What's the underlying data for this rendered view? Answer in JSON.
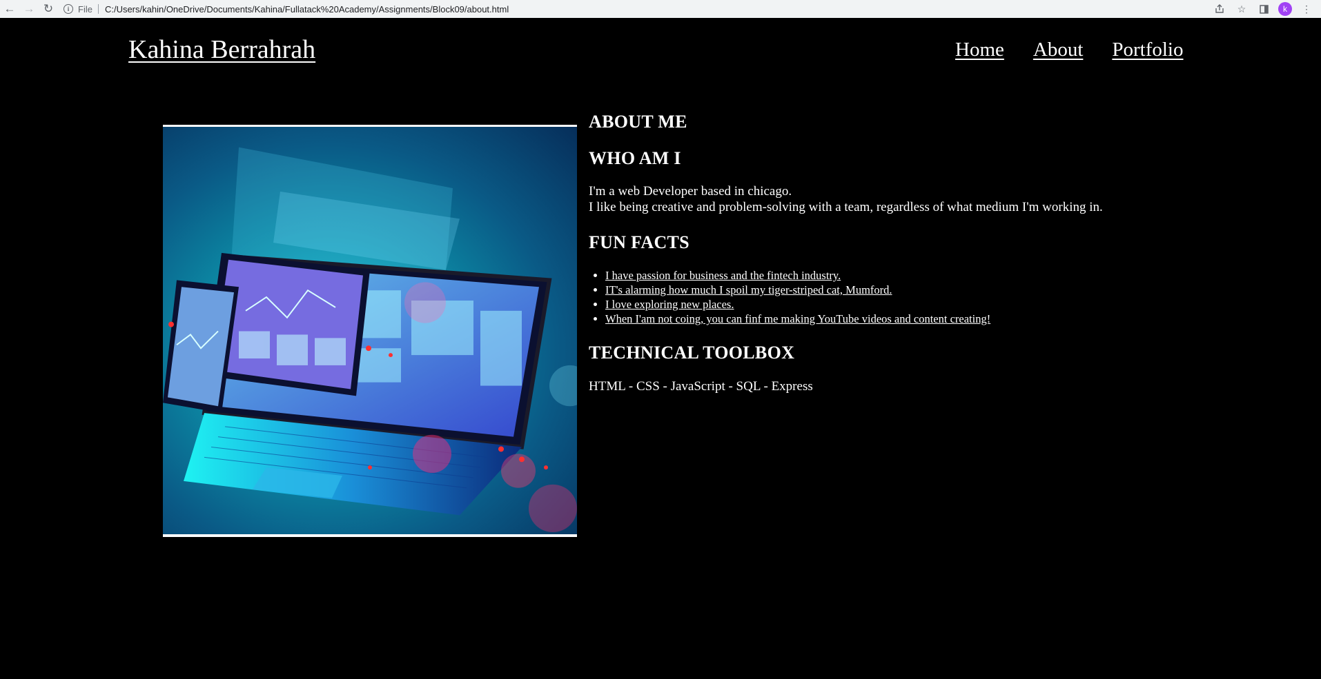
{
  "browser": {
    "back_icon": "arrow-left-icon",
    "forward_icon": "arrow-right-icon",
    "reload_icon": "reload-icon",
    "site_info_icon": "info-icon",
    "protocol_label": "File",
    "url": "C:/Users/kahin/OneDrive/Documents/Kahina/Fullatack%20Academy/Assignments/Block09/about.html",
    "profile_initial": "k"
  },
  "header": {
    "site_title": "Kahina Berrahrah",
    "nav": [
      "Home",
      "About",
      "Portfolio"
    ]
  },
  "main": {
    "about_heading": "ABOUT ME",
    "who_heading": "WHO AM I",
    "bio_line1": "I'm a web Developer based in chicago.",
    "bio_line2": "I like being creative and problem-solving with a team, regardless of what medium I'm working in.",
    "fun_heading": "FUN FACTS",
    "fun_facts": [
      "I have passion for business and the fintech industry.",
      "IT's alarming how much I spoil my tiger-striped cat, Mumford.",
      "I love exploring new places.",
      "When I'am not coing, you can finf me making YouTube videos and content creating!"
    ],
    "toolbox_heading": "TECHNICAL TOOLBOX",
    "toolbox": "HTML - CSS - JavaScript - SQL - Express"
  }
}
